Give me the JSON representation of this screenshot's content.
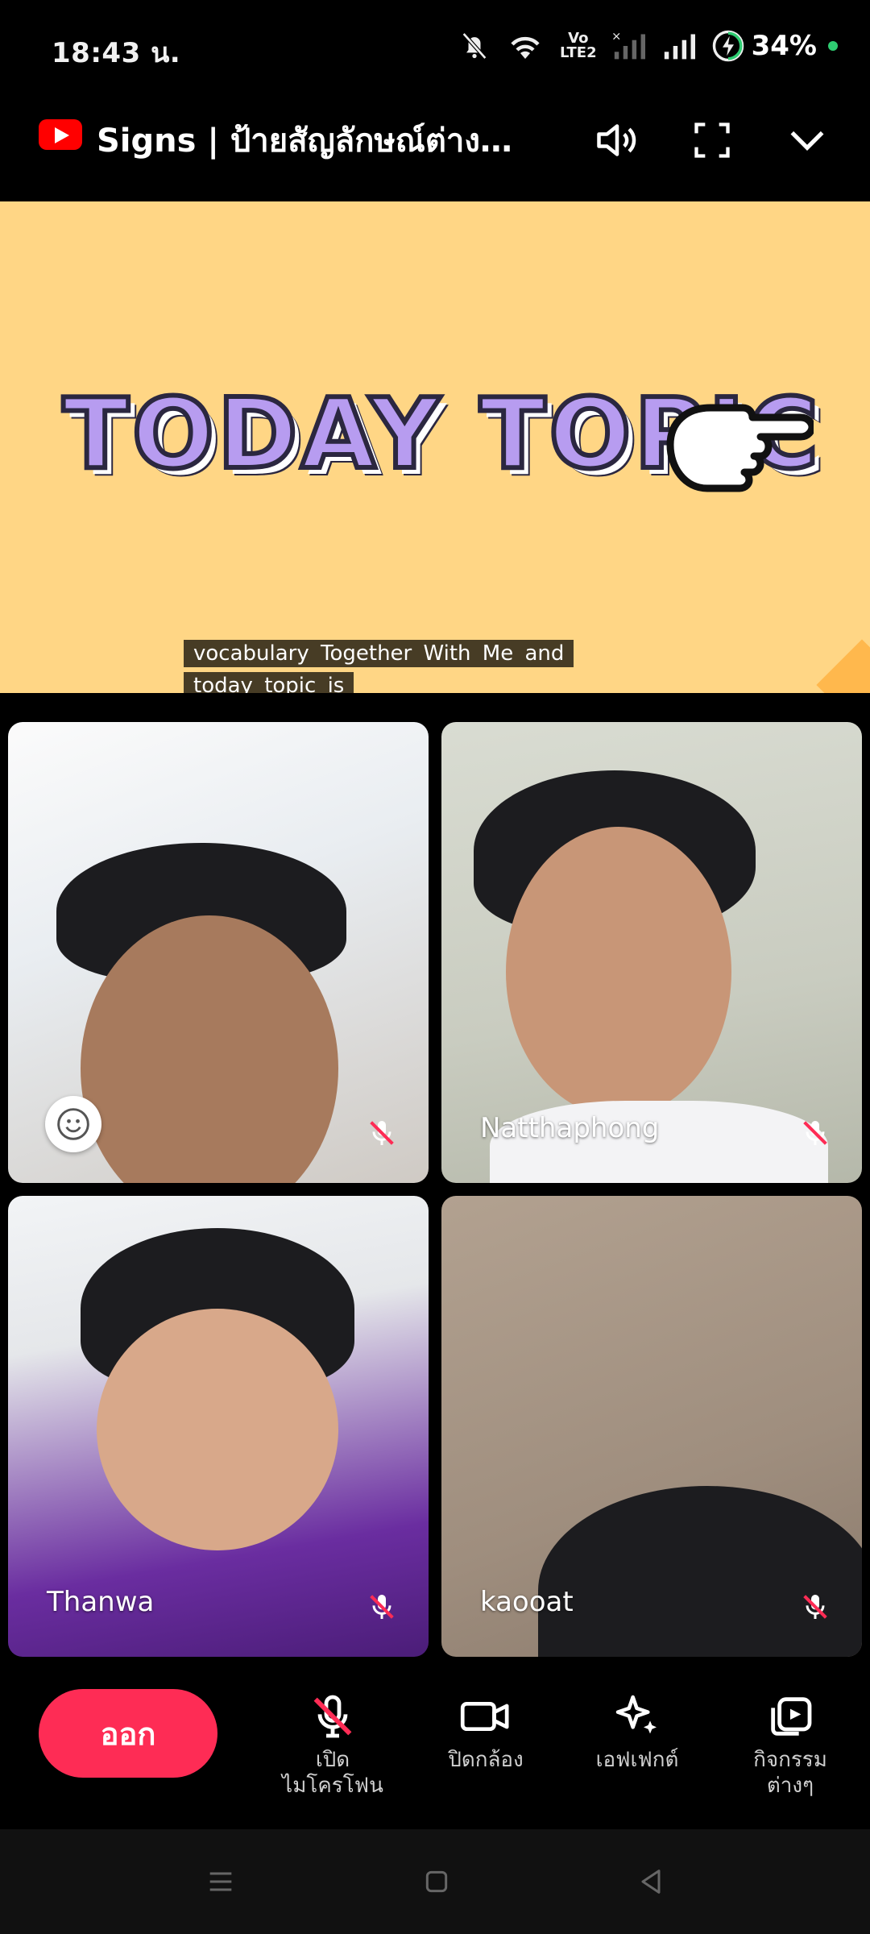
{
  "status_bar": {
    "time": "18:43 น.",
    "network_label_top": "Vo",
    "network_label_bottom": "LTE2",
    "battery": "34%"
  },
  "header": {
    "video_title": "Signs | ป้ายสัญลักษณ์ต่าง..."
  },
  "video": {
    "banner_text": "TODAY TOPIC",
    "caption_lines": [
      "vocabulary Together With Me and",
      "today topic is"
    ]
  },
  "participants": [
    {
      "name": "",
      "muted": true
    },
    {
      "name": "Natthaphong",
      "muted": true
    },
    {
      "name": "Thanwa",
      "muted": true
    },
    {
      "name": "kaooat",
      "muted": true
    }
  ],
  "controls": {
    "leave_label": "ออก",
    "mic_label_1": "เปิด",
    "mic_label_2": "ไมโครโฟน",
    "camera_label": "ปิดกล้อง",
    "effects_label": "เอฟเฟกต์",
    "activities_label_1": "กิจกรรม",
    "activities_label_2": "ต่างๆ"
  },
  "colors": {
    "leave_button": "#fe2c55",
    "video_background": "#ffd685",
    "banner_text": "#b79cf0"
  }
}
